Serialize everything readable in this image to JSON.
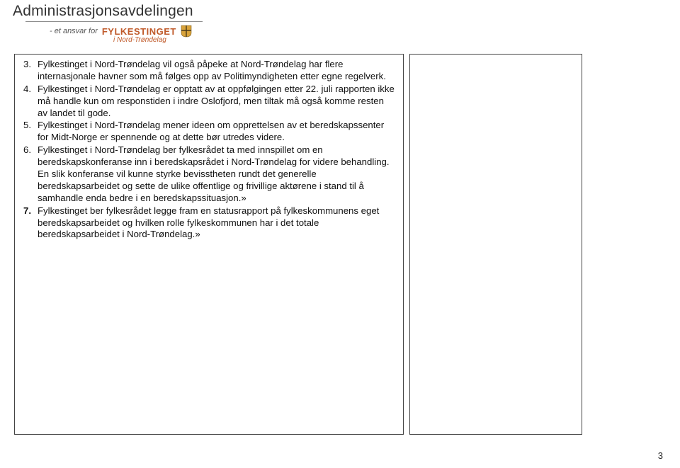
{
  "header": {
    "department": "Administrasjonsavdelingen",
    "tagline_prefix": "- et ansvar for",
    "brand": "FYLKESTINGET",
    "brand_sub": "i Nord-Trøndelag",
    "shield_color": "#d9a33a"
  },
  "list": {
    "items": [
      "Fylkestinget i Nord-Trøndelag vil også påpeke at Nord-Trøndelag har flere internasjonale havner som må følges opp av Politimyndigheten etter egne regelverk.",
      "Fylkestinget i Nord-Trøndelag er opptatt av at oppfølgingen etter 22. juli rapporten ikke må handle kun om responstiden i indre Oslofjord, men tiltak må også komme resten av landet til gode.",
      "Fylkestinget i Nord-Trøndelag mener ideen om opprettelsen av et beredskapssenter for Midt-Norge er spennende og at dette bør utredes videre.",
      "Fylkestinget i Nord-Trøndelag ber fylkesrådet ta med innspillet om en beredskapskonferanse inn i beredskapsrådet i Nord-Trøndelag for videre behandling. En slik konferanse vil kunne styrke bevisstheten rundt det generelle beredskapsarbeidet og sette de ulike offentlige og frivillige aktørene i stand til å samhandle enda bedre i en beredskapssituasjon.»",
      "Fylkestinget ber fylkesrådet legge fram en statusrapport på fylkeskommunens eget beredskapsarbeidet og hvilken rolle fylkeskommunen har i det totale beredskapsarbeidet i Nord-Trøndelag.»"
    ]
  },
  "page_number": "3"
}
